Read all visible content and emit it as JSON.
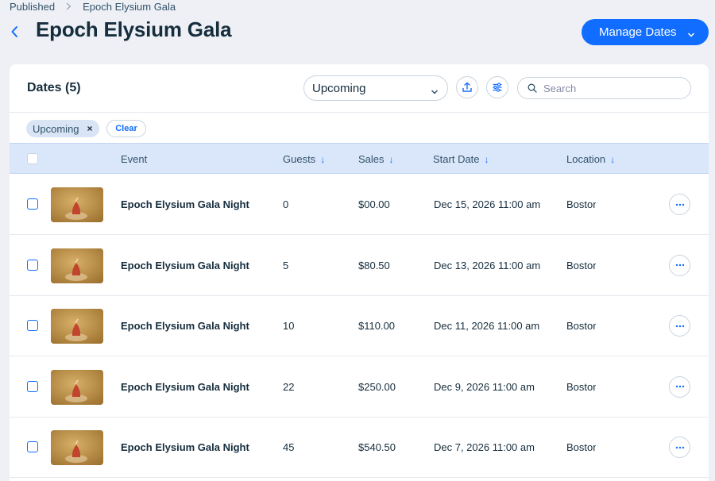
{
  "breadcrumb": {
    "parent": "Published",
    "current": "Epoch Elysium Gala"
  },
  "page": {
    "title": "Epoch Elysium Gala"
  },
  "header": {
    "manage_label": "Manage Dates"
  },
  "dates": {
    "title": "Dates (5)",
    "filter_select": "Upcoming",
    "search_placeholder": "Search",
    "tag": "Upcoming",
    "clear_label": "Clear"
  },
  "table": {
    "columns": {
      "event": "Event",
      "guests": "Guests",
      "sales": "Sales",
      "start": "Start Date",
      "location": "Location"
    },
    "rows": [
      {
        "event": "Epoch Elysium Gala Night",
        "guests": "0",
        "sales": "$00.00",
        "start": "Dec 15, 2026 11:00 am",
        "location": "Boston"
      },
      {
        "event": "Epoch Elysium Gala Night",
        "guests": "5",
        "sales": "$80.50",
        "start": "Dec 13, 2026 11:00 am",
        "location": "Boston"
      },
      {
        "event": "Epoch Elysium Gala Night",
        "guests": "10",
        "sales": "$110.00",
        "start": "Dec 11, 2026 11:00 am",
        "location": "Boston"
      },
      {
        "event": "Epoch Elysium Gala Night",
        "guests": "22",
        "sales": "$250.00",
        "start": "Dec 9, 2026 11:00 am",
        "location": "Boston"
      },
      {
        "event": "Epoch Elysium Gala Night",
        "guests": "45",
        "sales": "$540.50",
        "start": "Dec 7, 2026 11:00 am",
        "location": "Boston"
      }
    ]
  },
  "icons": {
    "back": "chevron-left-icon",
    "export": "upload-icon",
    "filter": "sliders-icon",
    "search": "search-icon",
    "more": "more-horizontal-icon"
  },
  "colors": {
    "accent": "#116dff",
    "header_row": "#dae6fa",
    "tag_bg": "#d9e5f5"
  }
}
